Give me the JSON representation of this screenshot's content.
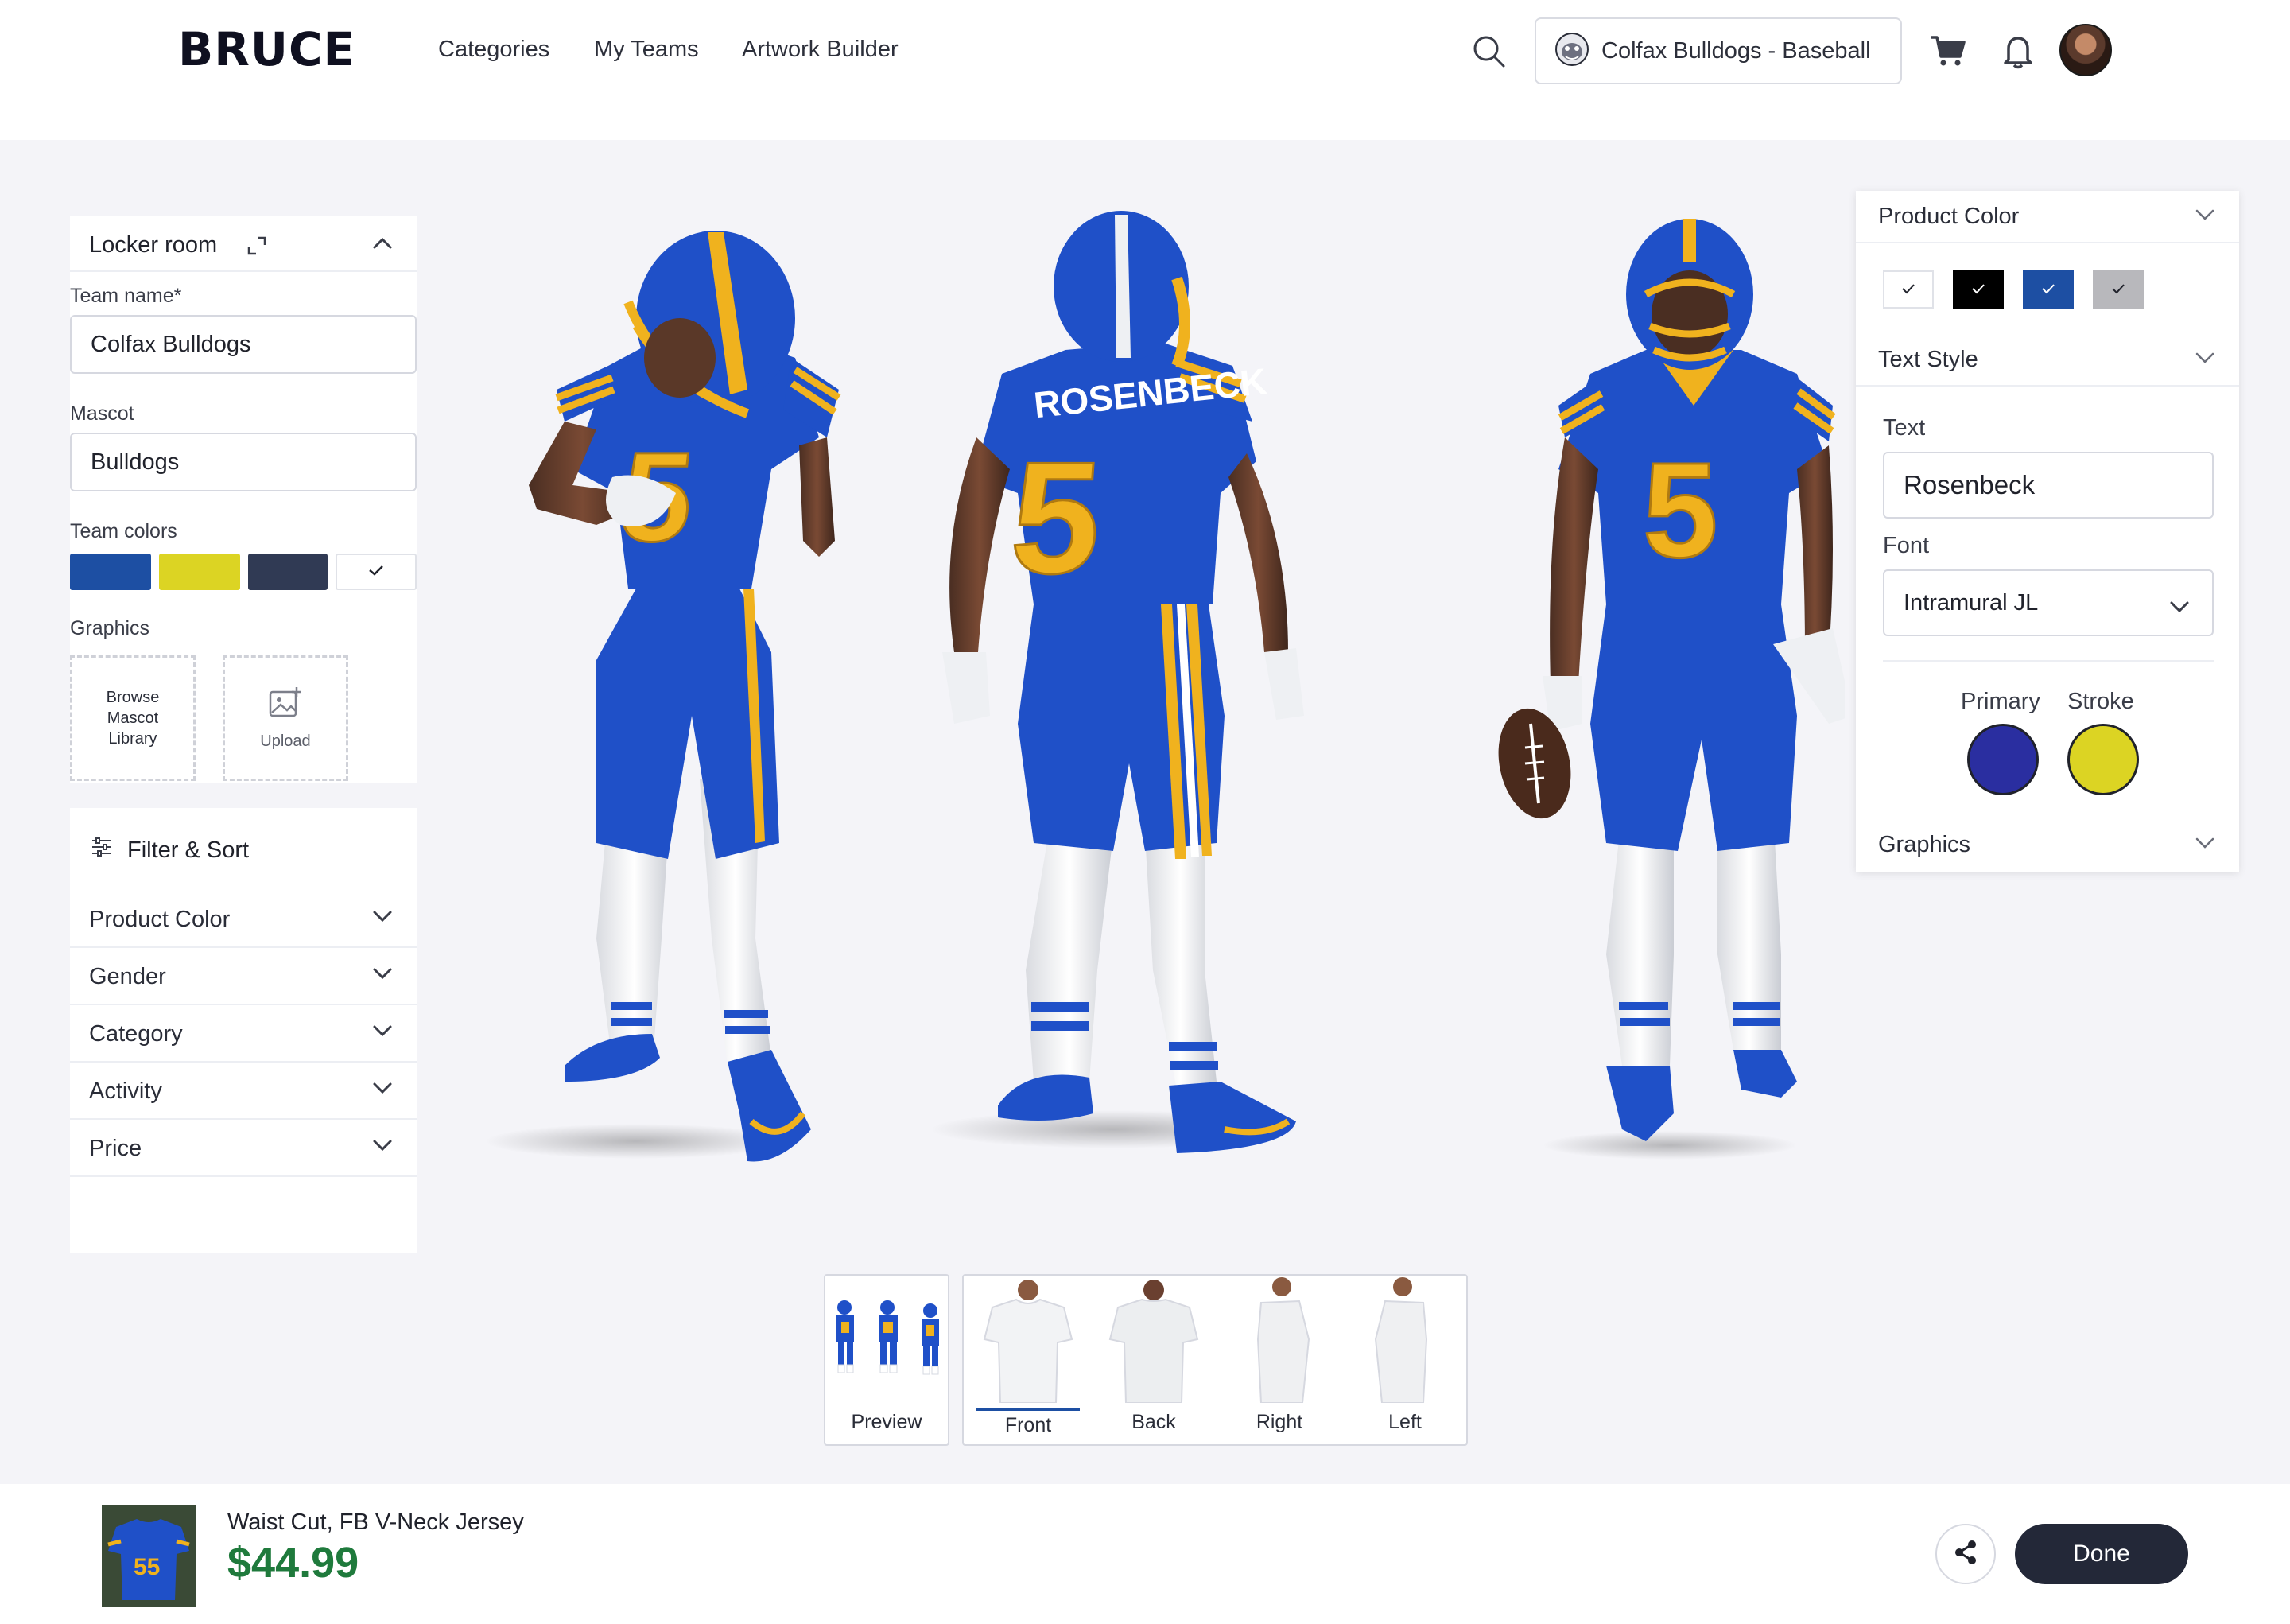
{
  "header": {
    "logo": "BRUCE",
    "nav": [
      "Categories",
      "My Teams",
      "Artwork Builder"
    ],
    "team_selector": "Colfax Bulldogs - Baseball"
  },
  "locker_room": {
    "title": "Locker room",
    "team_name_label": "Team name*",
    "team_name_value": "Colfax Bulldogs",
    "mascot_label": "Mascot",
    "mascot_value": "Bulldogs",
    "team_colors_label": "Team colors",
    "team_colors": [
      "#1d4fa3",
      "#dcd423",
      "#303a54",
      "#ffffff"
    ],
    "graphics_label": "Graphics",
    "browse_label": [
      "Browse",
      "Mascot",
      "Library"
    ],
    "upload_label": "Upload"
  },
  "filter": {
    "title": "Filter & Sort",
    "rows": [
      "Product Color",
      "Gender",
      "Category",
      "Activity",
      "Price"
    ]
  },
  "jersey": {
    "back_name": "ROSENBECK",
    "number": "5",
    "primary": "#1f50c8",
    "accent": "#f0b21e"
  },
  "right_panel": {
    "product_color_title": "Product Color",
    "product_colors": [
      "#ffffff",
      "#000000",
      "#1d4fa3",
      "#b8b8bc"
    ],
    "text_style_title": "Text Style",
    "text_label": "Text",
    "text_value": "Rosenbeck",
    "font_label": "Font",
    "font_value": "Intramural JL",
    "primary_label": "Primary",
    "stroke_label": "Stroke",
    "primary_color": "#2a2ea0",
    "stroke_color": "#dcd423",
    "graphics_title": "Graphics"
  },
  "views": {
    "preview_label": "Preview",
    "items": [
      "Front",
      "Back",
      "Right",
      "Left"
    ],
    "active": "Front"
  },
  "footer": {
    "product_name": "Waist Cut, FB V-Neck Jersey",
    "price": "$44.99",
    "thumb_number": "55",
    "done_label": "Done"
  }
}
